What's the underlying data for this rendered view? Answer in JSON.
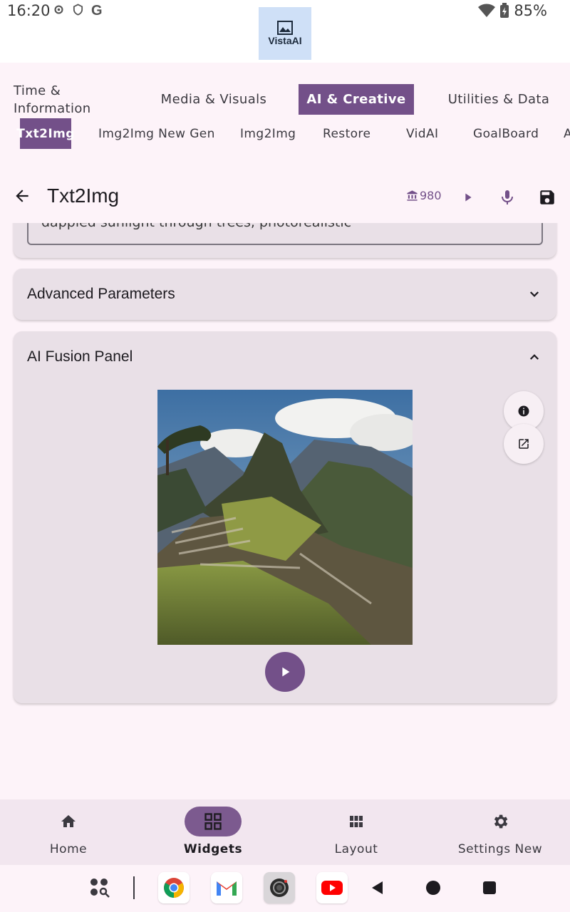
{
  "status_bar": {
    "time": "16:20",
    "battery": "85%",
    "left_icons": [
      "settings-icon",
      "vpn-shield-icon",
      "google-icon"
    ],
    "right_icons": [
      "wifi-icon",
      "battery-icon"
    ]
  },
  "app": {
    "logo_text": "VistaAI"
  },
  "category_tabs": [
    {
      "label": "Time & Information",
      "active": false
    },
    {
      "label": "Media & Visuals",
      "active": false
    },
    {
      "label": "AI & Creative",
      "active": true
    },
    {
      "label": "Utilities & Data",
      "active": false
    }
  ],
  "sub_tabs": [
    {
      "label": "Txt2Img",
      "active": true
    },
    {
      "label": "Img2Img New Gen",
      "active": false
    },
    {
      "label": "Img2Img",
      "active": false
    },
    {
      "label": "Restore",
      "active": false
    },
    {
      "label": "VidAI",
      "active": false
    },
    {
      "label": "GoalBoard",
      "active": false
    },
    {
      "label": "A",
      "active": false
    }
  ],
  "toolbar": {
    "title": "Txt2Img",
    "credits": "980",
    "icons": [
      "back-arrow-icon",
      "credits-bank-icon",
      "play-icon",
      "mic-icon",
      "save-icon"
    ]
  },
  "prompt": {
    "visible_text": "dappled sunlight through trees, photorealistic"
  },
  "advanced": {
    "title": "Advanced Parameters",
    "expanded": false
  },
  "fusion": {
    "title": "AI Fusion Panel",
    "expanded": true,
    "image_subject": "mountain-citadel-ruins-landscape",
    "side_buttons": [
      "info-icon",
      "open-external-icon"
    ]
  },
  "bottom_nav": [
    {
      "label": "Home",
      "icon": "home-icon",
      "active": false
    },
    {
      "label": "Widgets",
      "icon": "widgets-grid-icon",
      "active": true
    },
    {
      "label": "Layout",
      "icon": "layout-grid-icon",
      "active": false
    },
    {
      "label": "Settings New",
      "icon": "gear-icon",
      "active": false
    }
  ],
  "system_nav": [
    "app-search-icon",
    "chrome-icon",
    "gmail-icon",
    "camera-icon",
    "youtube-icon",
    "back-triangle-icon",
    "home-circle-icon",
    "recents-square-icon"
  ],
  "colors": {
    "accent": "#735089",
    "card": "#e9e0e7",
    "background": "#fdf3f9",
    "nav": "#f2e6ef"
  }
}
